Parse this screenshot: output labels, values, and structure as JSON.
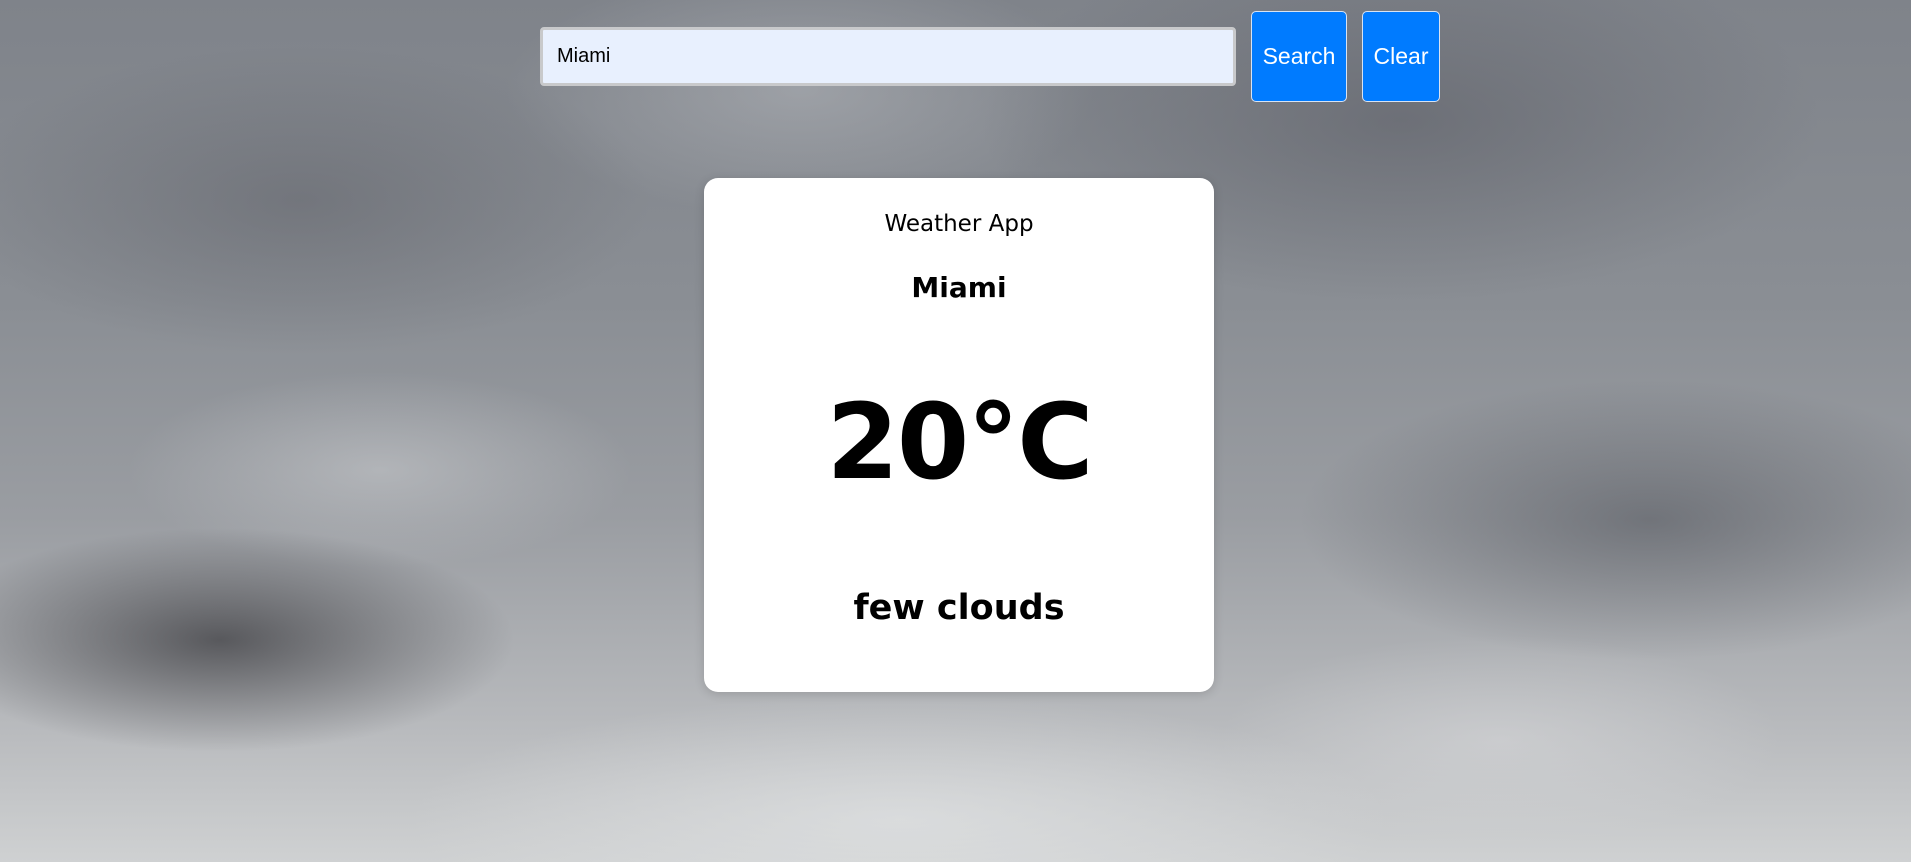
{
  "search": {
    "value": "Miami",
    "search_label": "Search",
    "clear_label": "Clear"
  },
  "card": {
    "app_title": "Weather App",
    "city": "Miami",
    "temperature": "20°C",
    "description": "few clouds"
  }
}
